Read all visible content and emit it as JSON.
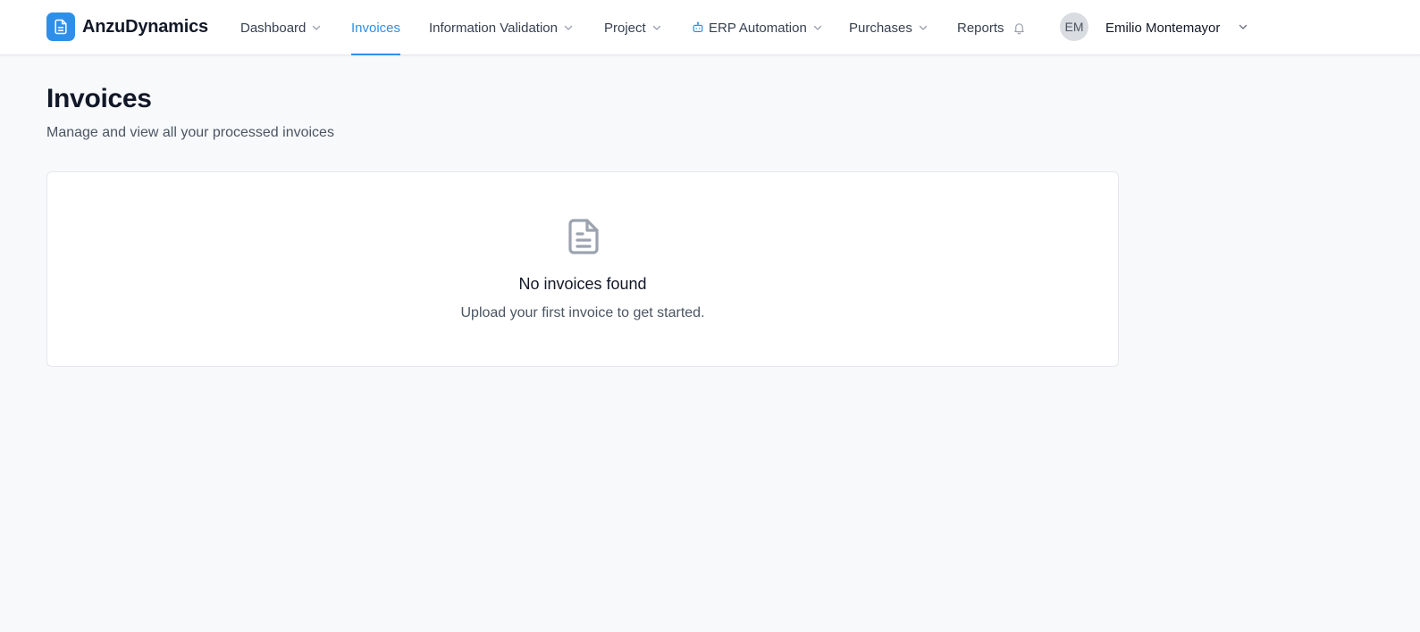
{
  "app": {
    "brand_name": "AnzuDynamics",
    "accent_color": "#2f8fe8"
  },
  "nav": {
    "items": [
      {
        "label": "Dashboard",
        "has_dropdown": true
      },
      {
        "label": "Invoices",
        "active": true
      },
      {
        "label": "Information Validation",
        "has_dropdown": true
      },
      {
        "label": "Project",
        "has_dropdown": true
      },
      {
        "label": "ERP Automation",
        "has_dropdown": true,
        "icon": "robot-icon"
      },
      {
        "label": "Purchases",
        "has_dropdown": true
      },
      {
        "label": "Reports",
        "icon": "bell-icon"
      }
    ]
  },
  "user": {
    "initials": "EM",
    "name": "Emilio Montemayor"
  },
  "page": {
    "title": "Invoices",
    "subtitle": "Manage and view all your processed invoices"
  },
  "empty_state": {
    "icon": "document-icon",
    "title": "No invoices found",
    "message": "Upload your first invoice to get started."
  }
}
